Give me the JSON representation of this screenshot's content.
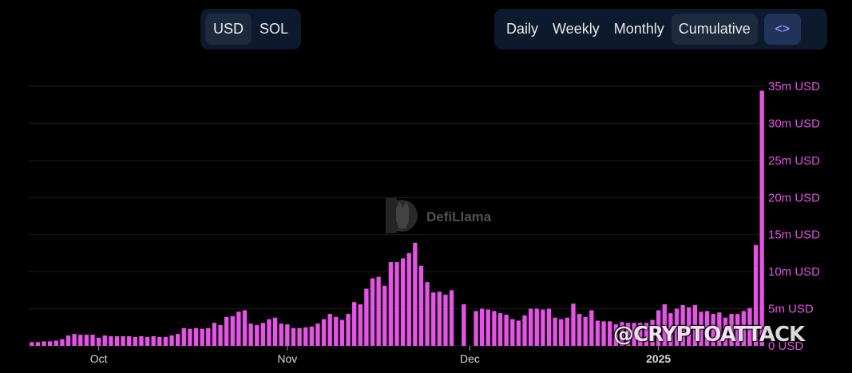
{
  "currency_toggle": {
    "options": [
      "USD",
      "SOL"
    ],
    "selected": "USD"
  },
  "period_toggle": {
    "options": [
      "Daily",
      "Weekly",
      "Monthly",
      "Cumulative"
    ],
    "selected": "Cumulative",
    "embed_icon": "code-icon",
    "embed_label": "<>"
  },
  "watermark": {
    "brand": "DefiLlama"
  },
  "credit": "@CRYPTOATTACK",
  "colors": {
    "bar": "#e653e6",
    "grid": "#1f1f1f",
    "background": "#000000",
    "accent_button": "#22335a"
  },
  "chart_data": {
    "type": "bar",
    "title": "",
    "xlabel": "",
    "ylabel": "",
    "y_axis_position": "right",
    "ylim": [
      0,
      35
    ],
    "y_unit": "m USD",
    "y_ticks": [
      "0 USD",
      "5m USD",
      "10m USD",
      "15m USD",
      "20m USD",
      "25m USD",
      "30m USD",
      "35m USD"
    ],
    "y_tick_values": [
      0,
      5,
      10,
      15,
      20,
      25,
      30,
      35
    ],
    "x_ticks": [
      {
        "label": "Oct",
        "index": 11,
        "bold": false
      },
      {
        "label": "Nov",
        "index": 42,
        "bold": false
      },
      {
        "label": "Dec",
        "index": 72,
        "bold": false
      },
      {
        "label": "2025",
        "index": 103,
        "bold": true
      }
    ],
    "grid": true,
    "series": [
      {
        "values": [
          0.5,
          0.5,
          0.6,
          0.6,
          0.7,
          0.9,
          1.4,
          1.6,
          1.5,
          1.5,
          1.5,
          1.1,
          1.4,
          1.3,
          1.3,
          1.3,
          1.3,
          1.2,
          1.3,
          1.2,
          1.3,
          1.2,
          1.2,
          1.4,
          1.6,
          2.4,
          2.3,
          2.4,
          2.3,
          2.4,
          3.1,
          2.8,
          3.9,
          4.0,
          4.6,
          4.8,
          3.0,
          2.8,
          3.1,
          3.6,
          3.8,
          3.0,
          2.9,
          2.4,
          2.4,
          2.5,
          2.6,
          3.0,
          3.6,
          4.3,
          3.9,
          3.5,
          4.3,
          5.9,
          5.6,
          7.7,
          9.1,
          9.3,
          8.1,
          11.3,
          11.3,
          11.8,
          12.5,
          13.9,
          10.8,
          8.6,
          7.2,
          7.3,
          6.9,
          7.5,
          0,
          5.6,
          0,
          4.7,
          5.0,
          4.9,
          4.7,
          4.4,
          4.2,
          3.6,
          3.4,
          4.1,
          5.0,
          5.0,
          4.9,
          5.0,
          3.8,
          3.6,
          3.8,
          5.7,
          4.3,
          3.9,
          4.8,
          3.4,
          3.3,
          3.3,
          2.9,
          3.2,
          3.1,
          3.1,
          3.1,
          3.1,
          3.5,
          4.8,
          5.6,
          4.4,
          5.0,
          5.5,
          5.2,
          5.5,
          4.6,
          4.7,
          4.3,
          4.5,
          3.8,
          4.3,
          4.3,
          4.7,
          5.1,
          13.6,
          34.4
        ]
      }
    ]
  }
}
